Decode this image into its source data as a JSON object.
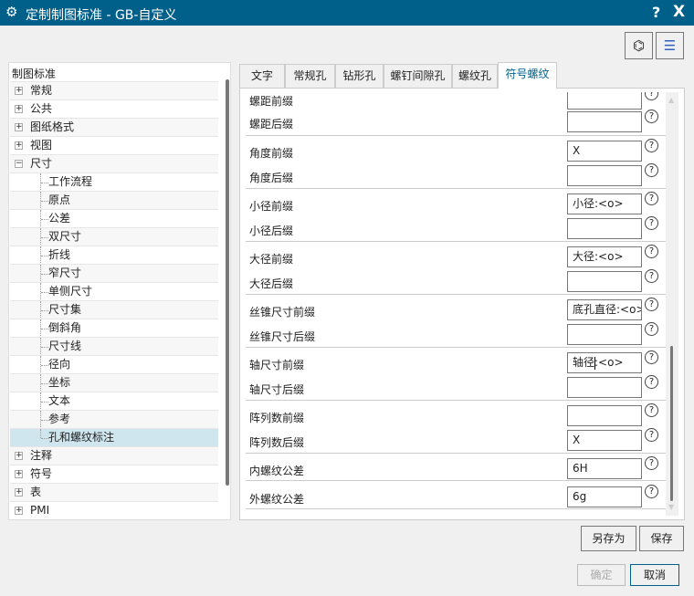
{
  "window": {
    "title": "定制制图标准 - GB-自定义",
    "help": "?",
    "close": "X"
  },
  "toolbar": {
    "find_icon": "binoculars-icon",
    "list_icon": "settings-list-icon"
  },
  "tree": {
    "header": "制图标准",
    "items": [
      {
        "label": "常规",
        "level": 0,
        "expander": "+"
      },
      {
        "label": "公共",
        "level": 0,
        "expander": "+"
      },
      {
        "label": "图纸格式",
        "level": 0,
        "expander": "+"
      },
      {
        "label": "视图",
        "level": 0,
        "expander": "+"
      },
      {
        "label": "尺寸",
        "level": 0,
        "expander": "−"
      },
      {
        "label": "工作流程",
        "level": 1
      },
      {
        "label": "原点",
        "level": 1
      },
      {
        "label": "公差",
        "level": 1
      },
      {
        "label": "双尺寸",
        "level": 1
      },
      {
        "label": "折线",
        "level": 1
      },
      {
        "label": "窄尺寸",
        "level": 1
      },
      {
        "label": "单侧尺寸",
        "level": 1
      },
      {
        "label": "尺寸集",
        "level": 1
      },
      {
        "label": "倒斜角",
        "level": 1
      },
      {
        "label": "尺寸线",
        "level": 1
      },
      {
        "label": "径向",
        "level": 1
      },
      {
        "label": "坐标",
        "level": 1
      },
      {
        "label": "文本",
        "level": 1
      },
      {
        "label": "参考",
        "level": 1
      },
      {
        "label": "孔和螺纹标注",
        "level": 1,
        "selected": true
      },
      {
        "label": "注释",
        "level": 0,
        "expander": "+"
      },
      {
        "label": "符号",
        "level": 0,
        "expander": "+"
      },
      {
        "label": "表",
        "level": 0,
        "expander": "+"
      },
      {
        "label": "PMI",
        "level": 0,
        "expander": "+"
      }
    ]
  },
  "tabs": [
    "文字",
    "常规孔",
    "钻形孔",
    "螺钉间隙孔",
    "螺纹孔",
    "符号螺纹"
  ],
  "active_tab": "符号螺纹",
  "fields": [
    {
      "label": "",
      "value": ""
    },
    {
      "label": "螺距后缀",
      "value": ""
    },
    {
      "label": "角度前缀",
      "value": "X"
    },
    {
      "label": "角度后缀",
      "value": ""
    },
    {
      "label": "小径前缀",
      "value": "小径:<o>"
    },
    {
      "label": "小径后缀",
      "value": ""
    },
    {
      "label": "大径前缀",
      "value": "大径:<o>"
    },
    {
      "label": "大径后缀",
      "value": ""
    },
    {
      "label": "丝锥尺寸前缀",
      "value": "底孔直径:<o>"
    },
    {
      "label": "丝锥尺寸后缀",
      "value": ""
    },
    {
      "label": "轴尺寸前缀",
      "value": "轴径:<o>"
    },
    {
      "label": "轴尺寸后缀",
      "value": ""
    },
    {
      "label": "阵列数前缀",
      "value": ""
    },
    {
      "label": "阵列数后缀",
      "value": "X"
    },
    {
      "label": "内螺纹公差",
      "value": "6H"
    },
    {
      "label": "外螺纹公差",
      "value": "6g"
    }
  ],
  "partial_label": "螺距前缀",
  "help_glyph": "?",
  "buttons": {
    "save_as": "另存为",
    "save": "保存",
    "ok": "确定",
    "cancel": "取消"
  }
}
